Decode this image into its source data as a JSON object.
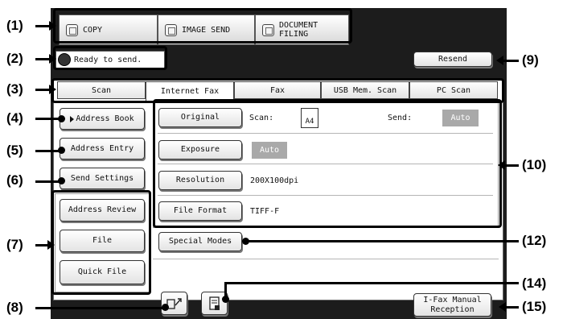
{
  "mode_tabs": [
    {
      "label": "COPY"
    },
    {
      "label": "IMAGE SEND"
    },
    {
      "label": "DOCUMENT\nFILING"
    }
  ],
  "status": {
    "message": "Ready to send."
  },
  "resend_label": "Resend",
  "tabs": [
    {
      "label": "Scan"
    },
    {
      "label": "Internet Fax"
    },
    {
      "label": "Fax"
    },
    {
      "label": "USB Mem. Scan"
    },
    {
      "label": "PC Scan"
    }
  ],
  "active_tab": "Internet Fax",
  "left_buttons": {
    "address_book": "Address Book",
    "address_entry": "Address Entry",
    "send_settings": "Send Settings",
    "address_review": "Address Review",
    "file": "File",
    "quick_file": "Quick File"
  },
  "settings": {
    "original": {
      "label": "Original",
      "scan_label": "Scan:",
      "scan_value": "A4",
      "send_label": "Send:",
      "send_value": "Auto"
    },
    "exposure": {
      "label": "Exposure",
      "value": "Auto"
    },
    "resolution": {
      "label": "Resolution",
      "value": "200X100dpi"
    },
    "file_format": {
      "label": "File Format",
      "value": "TIFF-F"
    }
  },
  "special_modes_label": "Special Modes",
  "ifax_manual_reception": "I-Fax Manual\nReception",
  "callouts": [
    "(1)",
    "(2)",
    "(3)",
    "(4)",
    "(5)",
    "(6)",
    "(7)",
    "(8)",
    "(9)",
    "(10)",
    "(12)",
    "(14)",
    "(15)"
  ],
  "colors": {
    "screen_bg": "#1c1c1c",
    "auto_badge": "#a9a9a9",
    "callout": "#000000"
  }
}
